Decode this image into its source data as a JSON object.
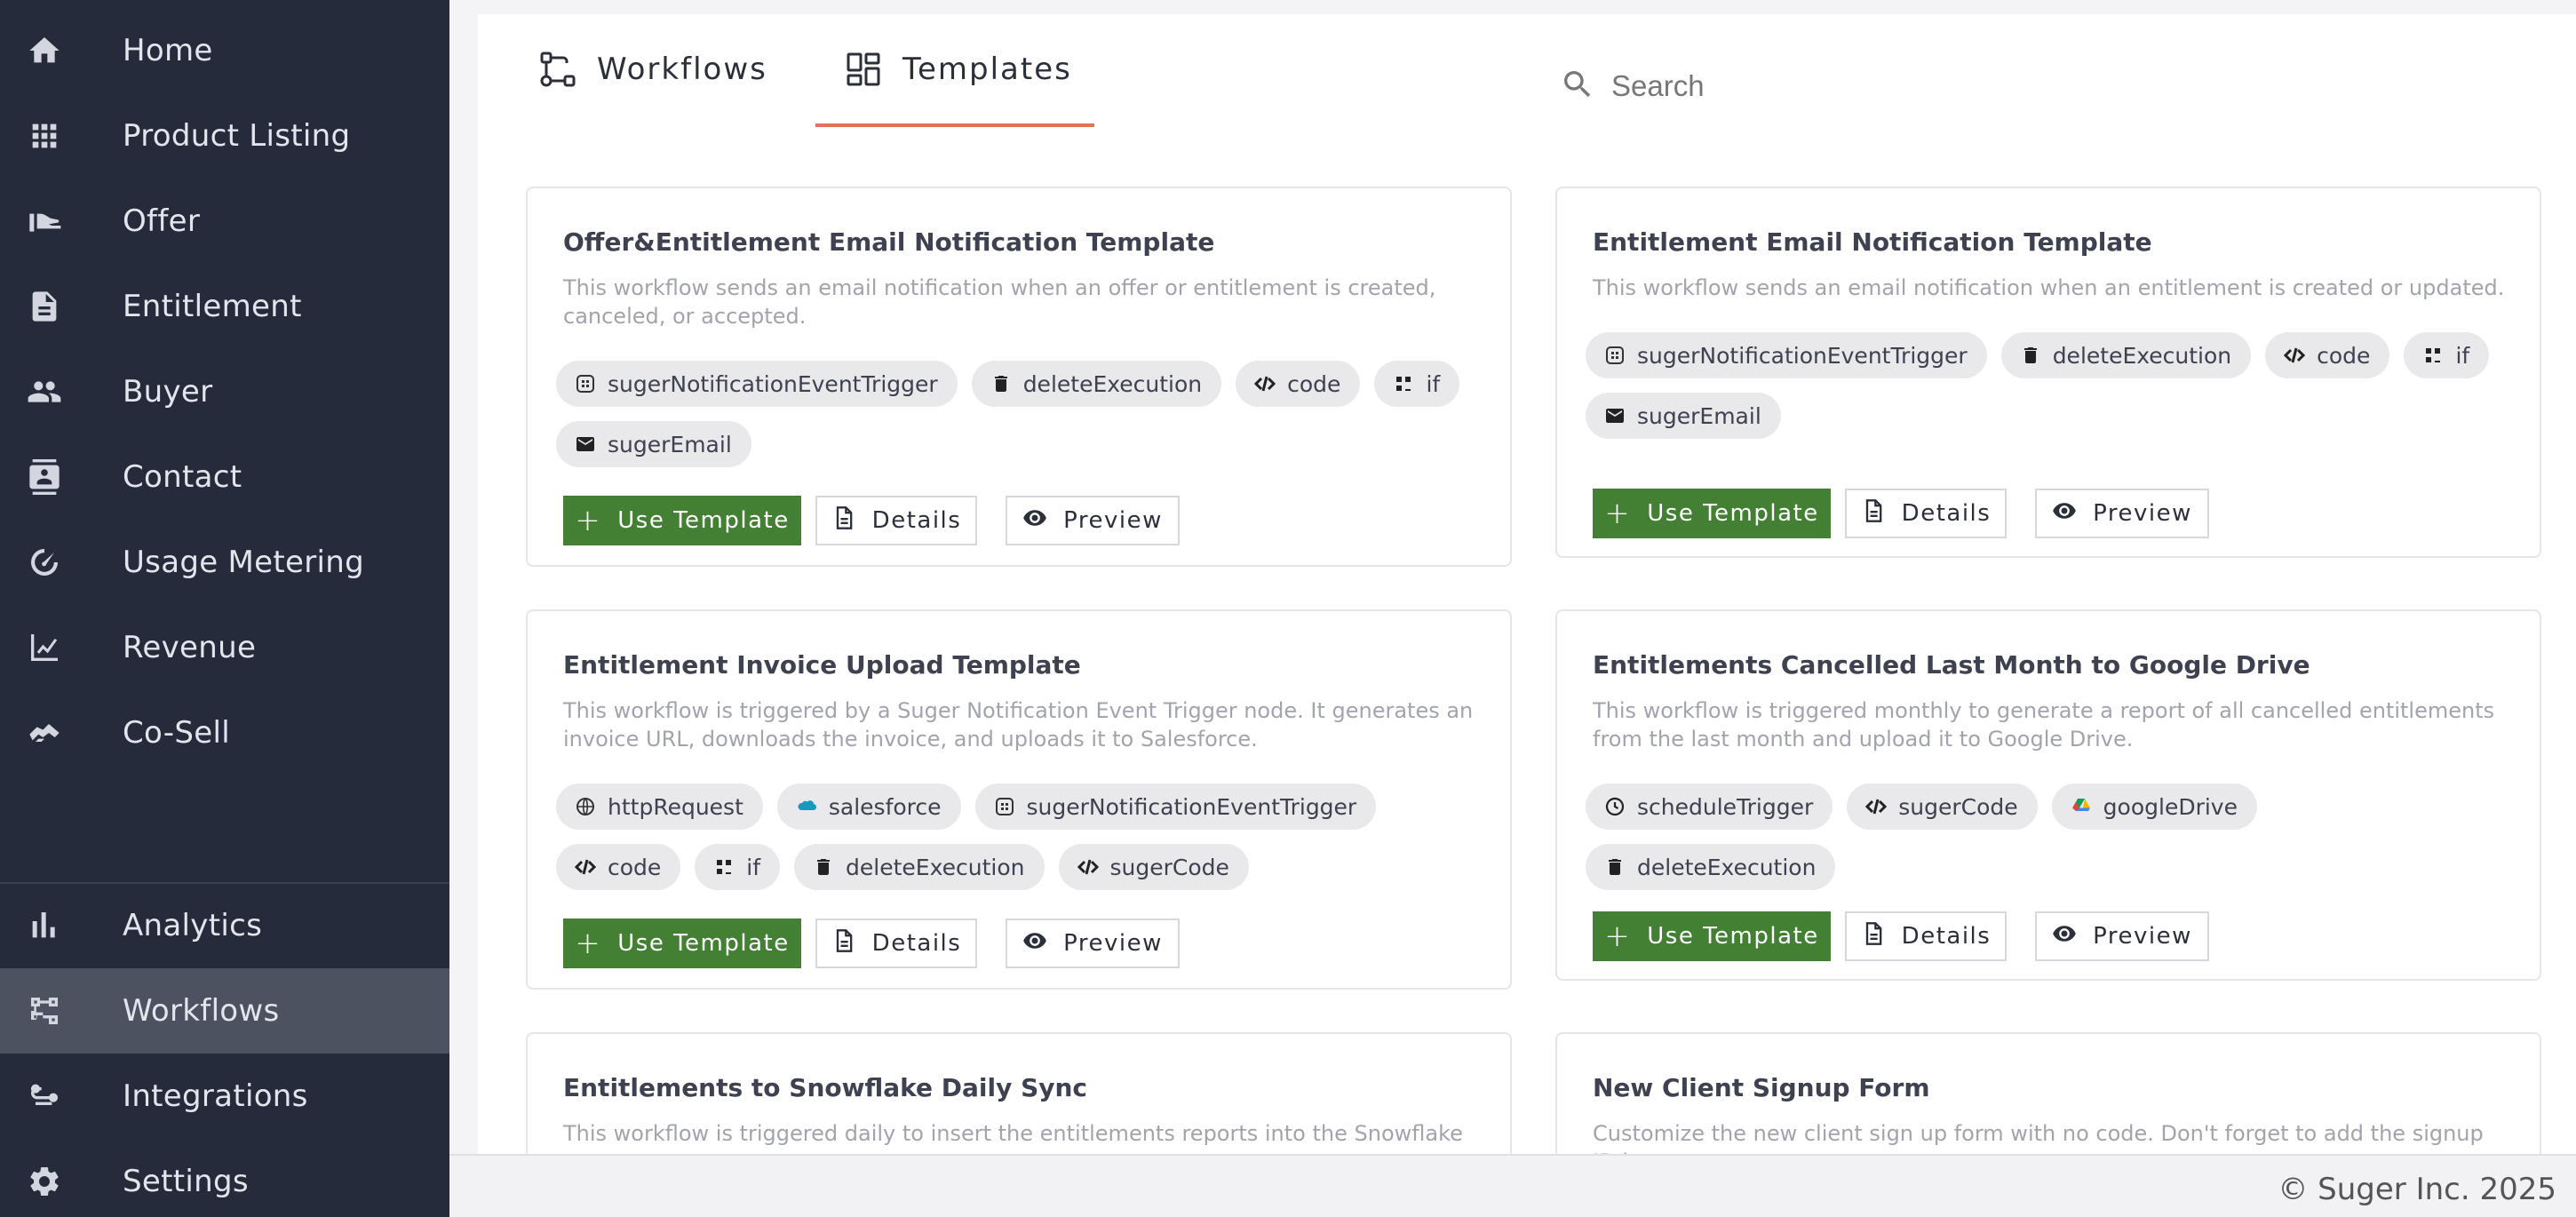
{
  "sidebar": {
    "items": [
      {
        "label": "Home",
        "icon": "home-icon"
      },
      {
        "label": "Product Listing",
        "icon": "grid-icon"
      },
      {
        "label": "Offer",
        "icon": "hand-offer-icon"
      },
      {
        "label": "Entitlement",
        "icon": "document-icon"
      },
      {
        "label": "Buyer",
        "icon": "people-icon"
      },
      {
        "label": "Contact",
        "icon": "contact-card-icon"
      },
      {
        "label": "Usage Metering",
        "icon": "speedometer-icon"
      },
      {
        "label": "Revenue",
        "icon": "revenue-chart-icon"
      },
      {
        "label": "Co-Sell",
        "icon": "handshake-icon"
      }
    ],
    "bottom_items": [
      {
        "label": "Analytics",
        "icon": "bar-chart-icon"
      },
      {
        "label": "Workflows",
        "icon": "workflow-icon",
        "active": true
      },
      {
        "label": "Integrations",
        "icon": "integrations-icon"
      },
      {
        "label": "Settings",
        "icon": "gear-icon"
      }
    ]
  },
  "tabs": [
    {
      "label": "Workflows",
      "icon": "workflow-icon"
    },
    {
      "label": "Templates",
      "icon": "templates-icon",
      "active": true
    }
  ],
  "search": {
    "placeholder": "Search"
  },
  "buttons": {
    "use_template": "Use Template",
    "details": "Details",
    "preview": "Preview"
  },
  "cards": [
    {
      "title": "Offer&Entitlement Email Notification Template",
      "description": "This workflow sends an email notification when an offer or entitlement is created, canceled, or accepted.",
      "chips": [
        {
          "label": "sugerNotificationEventTrigger",
          "icon": "suger-trigger-icon"
        },
        {
          "label": "deleteExecution",
          "icon": "trash-icon"
        },
        {
          "label": "code",
          "icon": "code-icon"
        },
        {
          "label": "if",
          "icon": "if-icon"
        },
        {
          "label": "sugerEmail",
          "icon": "envelope-icon"
        }
      ]
    },
    {
      "title": "Entitlement Email Notification Template",
      "description": "This workflow sends an email notification when an entitlement is created or updated.",
      "chips": [
        {
          "label": "sugerNotificationEventTrigger",
          "icon": "suger-trigger-icon"
        },
        {
          "label": "deleteExecution",
          "icon": "trash-icon"
        },
        {
          "label": "code",
          "icon": "code-icon"
        },
        {
          "label": "if",
          "icon": "if-icon"
        },
        {
          "label": "sugerEmail",
          "icon": "envelope-icon"
        }
      ]
    },
    {
      "title": "Entitlement Invoice Upload Template",
      "description": "This workflow is triggered by a Suger Notification Event Trigger node. It generates an invoice URL, downloads the invoice, and uploads it to Salesforce.",
      "chips": [
        {
          "label": "httpRequest",
          "icon": "globe-icon"
        },
        {
          "label": "salesforce",
          "icon": "salesforce-cloud-icon"
        },
        {
          "label": "sugerNotificationEventTrigger",
          "icon": "suger-trigger-icon"
        },
        {
          "label": "code",
          "icon": "code-icon"
        },
        {
          "label": "if",
          "icon": "if-icon"
        },
        {
          "label": "deleteExecution",
          "icon": "trash-icon"
        },
        {
          "label": "sugerCode",
          "icon": "code-icon"
        }
      ]
    },
    {
      "title": "Entitlements Cancelled Last Month to Google Drive",
      "description": "This workflow is triggered monthly to generate a report of all cancelled entitlements from the last month and upload it to Google Drive.",
      "chips": [
        {
          "label": "scheduleTrigger",
          "icon": "clock-icon"
        },
        {
          "label": "sugerCode",
          "icon": "code-icon"
        },
        {
          "label": "googleDrive",
          "icon": "google-drive-icon"
        },
        {
          "label": "deleteExecution",
          "icon": "trash-icon"
        }
      ]
    },
    {
      "title": "Entitlements to Snowflake Daily Sync",
      "description": "This workflow is triggered daily to insert the entitlements reports into the Snowflake",
      "chips": []
    },
    {
      "title": "New Client Signup Form",
      "description": "Customize the new client sign up form with no code. Don't forget to add the signup ID in",
      "chips": []
    }
  ],
  "footer": {
    "text": "© Suger Inc. 2025"
  }
}
